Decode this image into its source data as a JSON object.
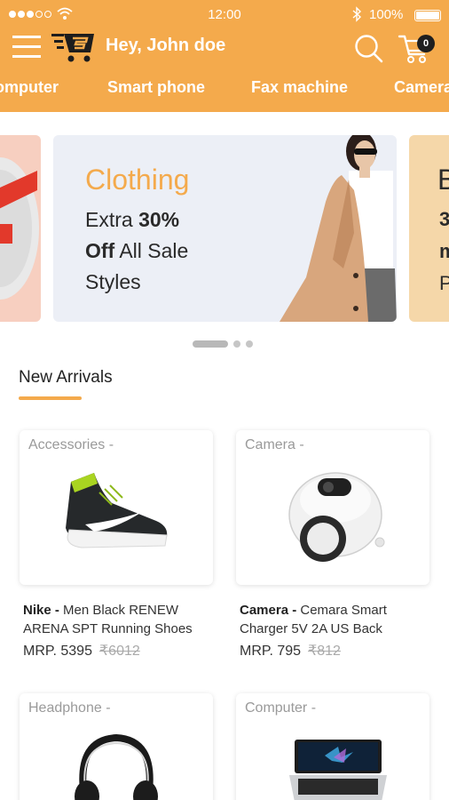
{
  "status_bar": {
    "time": "12:00",
    "battery": "100%"
  },
  "header": {
    "greeting": "Hey, John doe",
    "cart_count": "0",
    "accent_color": "#f4aa4c"
  },
  "categories": [
    "omputer",
    "Smart phone",
    "Fax machine",
    "Camera"
  ],
  "banners": {
    "main": {
      "title": "Clothing",
      "line1_pre": "Extra ",
      "line1_bold": "30%",
      "line2_bold": "Off",
      "line2_rest": " All Sale",
      "line3": "Styles"
    },
    "next": {
      "letter": "B",
      "t1": "3",
      "t2": "m",
      "t3": "P"
    }
  },
  "section": {
    "title": "New Arrivals"
  },
  "products": [
    {
      "category": "Accessories -",
      "brand": "Nike - ",
      "name_line1": "Men Black RENEW",
      "name_line2": "ARENA SPT Running Shoes",
      "price": "MRP. 5395",
      "old_price": "₹6012",
      "image": "running-shoe"
    },
    {
      "category": "Camera  -",
      "brand": "Camera - ",
      "name_line1": "Cemara Smart",
      "name_line2": "Charger 5V 2A US Back",
      "price": "MRP. 795",
      "old_price": "₹812",
      "image": "robot-camera"
    },
    {
      "category": "Headphone -",
      "image": "headphones"
    },
    {
      "category": "Computer  -",
      "image": "laptop"
    }
  ]
}
